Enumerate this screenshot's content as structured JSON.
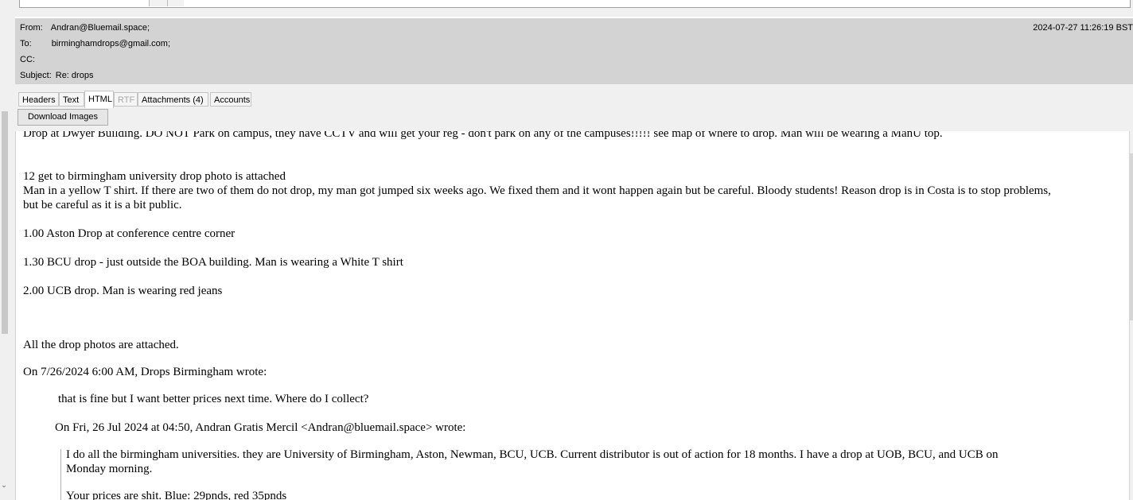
{
  "header": {
    "from_label": "From:",
    "from_value": "Andran@Bluemail.space;",
    "to_label": "To:",
    "to_value": "birminghamdrops@gmail.com;",
    "cc_label": "CC:",
    "subject_label": "Subject:",
    "subject_value": "Re: drops",
    "date": "2024-07-27 11:26:19 BST"
  },
  "tabs": [
    {
      "label": "Headers"
    },
    {
      "label": "Text"
    },
    {
      "label": "HTML"
    },
    {
      "label": "RTF"
    },
    {
      "label": "Attachments (4)"
    },
    {
      "label": "Accounts"
    }
  ],
  "toolbar": {
    "download_images": "Download Images"
  },
  "body": {
    "line_top": "Drop at Dwyer Building. DO NOT Park on campus, they have CCTV and will get your reg - don't park on any of the campuses!!!!! see map of where to drop. Man will be wearing a ManU top.",
    "line_12": "12 get to birmingham university drop photo is attached",
    "line_yellow_1": "Man in a yellow T shirt. If there are two of them do not drop, my man got jumped six weeks ago. We fixed them and it wont happen again but be careful. Bloody students! Reason drop is in Costa is to stop problems,",
    "line_yellow_2": "but be careful as it is a bit public.",
    "line_aston": "1.00 Aston Drop at conference centre corner",
    "line_bcu": "1.30 BCU drop - just outside the BOA building. Man is wearing a White T shirt",
    "line_ucb": "2.00 UCB drop. Man is wearing red jeans",
    "line_photos": "All the drop photos are attached.",
    "line_wrote_1": "On 7/26/2024 6:00 AM, Drops Birmingham wrote:",
    "line_fine": "that is fine but I want better prices next time. Where do I collect?",
    "line_wrote_2": "On Fri, 26 Jul 2024 at 04:50, Andran Gratis Mercil <Andran@bluemail.space> wrote:",
    "line_unis_1": "I do all the birmingham universities. they are University of Birmingham, Aston, Newman, BCU, UCB. Current distributor is out of action for 18 months. I have a drop at UOB, BCU, and UCB on",
    "line_unis_2": "Monday morning.",
    "line_prices": "Your prices are shit. Blue: 29pnds, red 35pnds"
  },
  "icons": {
    "scroll_down": "chevron-down-icon"
  }
}
